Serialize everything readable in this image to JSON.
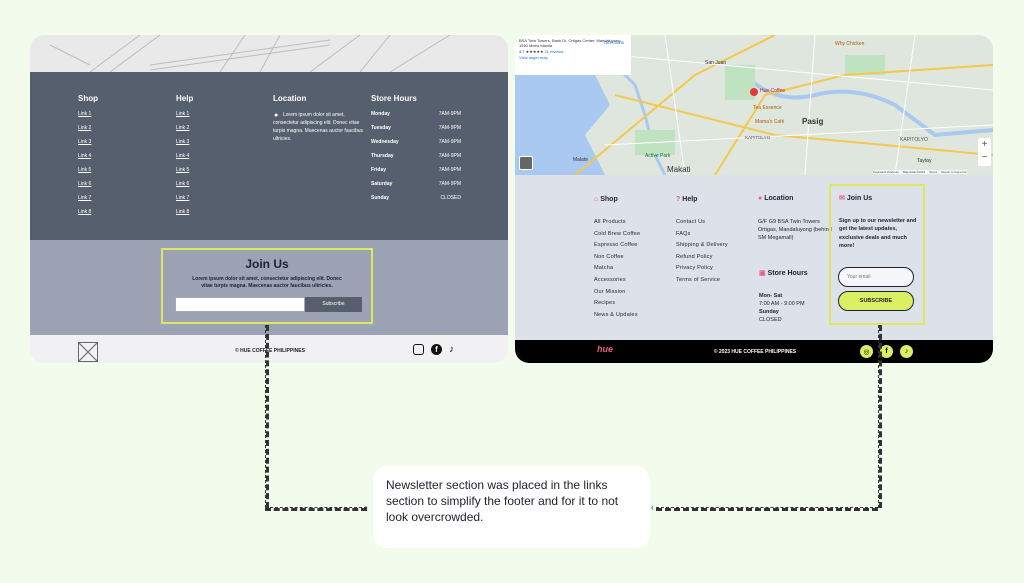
{
  "wireframe": {
    "columns": {
      "shop": {
        "title": "Shop",
        "links": [
          "Link 1",
          "Link 2",
          "Link 3",
          "Link 4",
          "Link 5",
          "Link 6",
          "Link 7",
          "Link 8"
        ]
      },
      "help": {
        "title": "Help",
        "links": [
          "Link 1",
          "Link 2",
          "Link 3",
          "Link 4",
          "Link 5",
          "Link 6",
          "Link 7",
          "Link 8"
        ]
      },
      "location": {
        "title": "Location",
        "text": "Lorem ipsum dolor sit amet, consectetur adipiscing elit. Donec vitae turpis magna. Maecenas auctor faucibus ultricies."
      },
      "hours": {
        "title": "Store Hours",
        "rows": [
          {
            "day": "Monday",
            "time": "7AM-9PM"
          },
          {
            "day": "Tuesday",
            "time": "7AM-9PM"
          },
          {
            "day": "Wednesday",
            "time": "7AM-9PM"
          },
          {
            "day": "Thursday",
            "time": "7AM-9PM"
          },
          {
            "day": "Friday",
            "time": "7AM-9PM"
          },
          {
            "day": "Saturday",
            "time": "7AM-9PM"
          },
          {
            "day": "Sunday",
            "time": "CLOSED"
          }
        ]
      }
    },
    "join": {
      "title": "Join Us",
      "desc": "Lorem ipsum dolor sit amet, consectetur adipiscing elit. Donec vitae turpis magna. Maecenas auctor faucibus ultricies.",
      "button": "Subscribe"
    },
    "copyright": "© HUE COFFEE PHILIPPINES"
  },
  "final": {
    "map": {
      "place": "BSA Twin Towers, Bank Dr, Ortigas Center, Mandaluyong, 1550 Metro Manila",
      "rating": "4.7 ★★★★★",
      "reviews": "11 reviews",
      "directions": "Directions",
      "larger": "View larger map",
      "labels": [
        "San Juan",
        "Pasig",
        "Makati",
        "Taytay",
        "Hue Coffee",
        "Tea Essence",
        "Mama's Café",
        "Why Chicken",
        "SM Megamall",
        "KAPITOLYO",
        "SAN ROQUE",
        "Active Park",
        "Sacred Heart",
        "Malate",
        "Ortigas"
      ],
      "footer": [
        "Keyboard shortcuts",
        "Map data ©2023",
        "Terms",
        "Report a map error"
      ]
    },
    "shop": {
      "title": "Shop",
      "links": [
        "All Products",
        "Cold Brew Coffee",
        "Espresso Coffee",
        "Non Coffee",
        "Matcha",
        "Accessories",
        "Our Mission",
        "Recipes",
        "News & Updates"
      ]
    },
    "help": {
      "title": "Help",
      "links": [
        "Contact Us",
        "FAQs",
        "Shipping & Delivery",
        "Refund Policy",
        "Privacy Policy",
        "Terms of Service"
      ]
    },
    "location": {
      "title": "Location",
      "text": "G/F G9 BSA Twin Towers Ortigas, Mandaluyong (behind SM Megamall)"
    },
    "hours": {
      "title": "Store Hours",
      "weekday": "Mon- Sat",
      "weekday_time": "7:00 AM - 9:00 PM",
      "sunday": "Sunday",
      "sunday_time": "CLOSED"
    },
    "join": {
      "title": "Join Us",
      "desc": "Sign up to our newsletter and get the latest updates, exclusive deals and much more!",
      "placeholder": "Your email",
      "button": "SUBSCRIBE"
    },
    "copyright": "© 2023 HUE COFFEE PHILIPPINES",
    "logo": "hue"
  },
  "note": "Newsletter section was placed in the links section to simplify the footer and for it to not look overcrowded.",
  "colors": {
    "accent": "#dce860",
    "wire_dark": "#555f6d",
    "final_bg": "#dde1ea"
  }
}
